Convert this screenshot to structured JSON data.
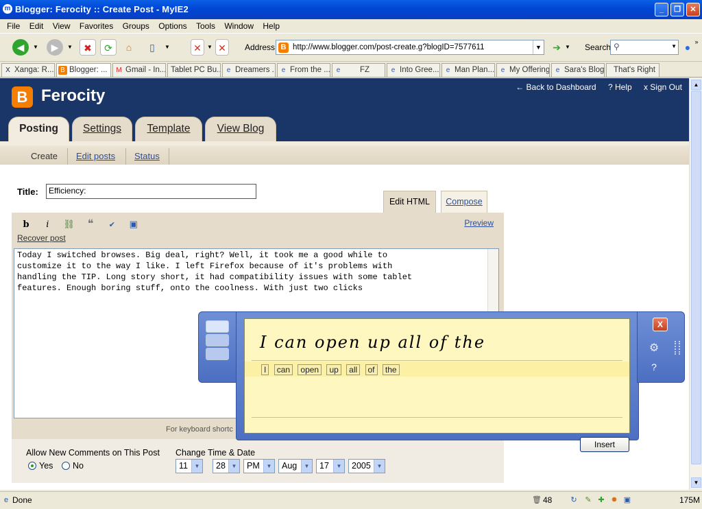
{
  "window": {
    "title": "Blogger: Ferocity :: Create Post - MyIE2",
    "app_icon": "m"
  },
  "menu": [
    "File",
    "Edit",
    "View",
    "Favorites",
    "Groups",
    "Options",
    "Tools",
    "Window",
    "Help"
  ],
  "toolbar": {
    "address_label": "Address",
    "url": "http://www.blogger.com/post-create.g?blogID=7577611",
    "search_label": "Search"
  },
  "tabs": [
    {
      "label": "Xanga: R...",
      "icon": "X"
    },
    {
      "label": "Blogger: ...",
      "icon": "B"
    },
    {
      "label": "Gmail - In...",
      "icon": "M"
    },
    {
      "label": "Tablet PC Bu...",
      "icon": ""
    },
    {
      "label": "Dreamers ...",
      "icon": "e"
    },
    {
      "label": "From the ...",
      "icon": "e"
    },
    {
      "label": "FZ",
      "icon": "e"
    },
    {
      "label": "Into Gree...",
      "icon": "e"
    },
    {
      "label": "Man Plan...",
      "icon": "e"
    },
    {
      "label": "My Offering",
      "icon": "e"
    },
    {
      "label": "Sara's Blog",
      "icon": "e"
    },
    {
      "label": "That's Right",
      "icon": ""
    }
  ],
  "blog": {
    "logo": "B",
    "name": "Ferocity",
    "top_links": {
      "dashboard": "← Back to Dashboard",
      "help": "? Help",
      "signout": "x Sign Out"
    },
    "nav_tabs": {
      "posting": "Posting",
      "settings": "Settings",
      "template": "Template",
      "viewblog": "View Blog"
    },
    "subnav": {
      "create": "Create",
      "edit": "Edit posts",
      "status": "Status"
    }
  },
  "post": {
    "title_label": "Title:",
    "title_value": "Efficiency:",
    "mode_tabs": {
      "edit_html": "Edit HTML",
      "compose": "Compose"
    },
    "toolbar": {
      "bold": "b",
      "italic": "i",
      "preview": "Preview",
      "recover": "Recover post"
    },
    "body": "Today I switched browses. Big deal, right? Well, it took me a good while to\ncustomize it to the way I like. I left Firefox because of it's problems with\nhandling the TIP. Long story short, it had compatibility issues with some tablet\nfeatures. Enough boring stuff, onto the coolness. With just two clicks",
    "keyboard_hint": "For keyboard shortc"
  },
  "options": {
    "comments_label": "Allow New Comments on This Post",
    "yes": "Yes",
    "no": "No",
    "time_label": "Change Time & Date",
    "hour": "11",
    "minute": "28",
    "ampm": "PM",
    "month": "Aug",
    "day": "17",
    "year": "2005",
    "colon": ":"
  },
  "tip": {
    "ink_text": "I can open up all of the",
    "words": [
      "I",
      "can",
      "open",
      "up",
      "all",
      "of",
      "the"
    ],
    "insert": "Insert",
    "close": "X"
  },
  "status": {
    "text": "Done",
    "count": "48",
    "memory": "175M"
  }
}
